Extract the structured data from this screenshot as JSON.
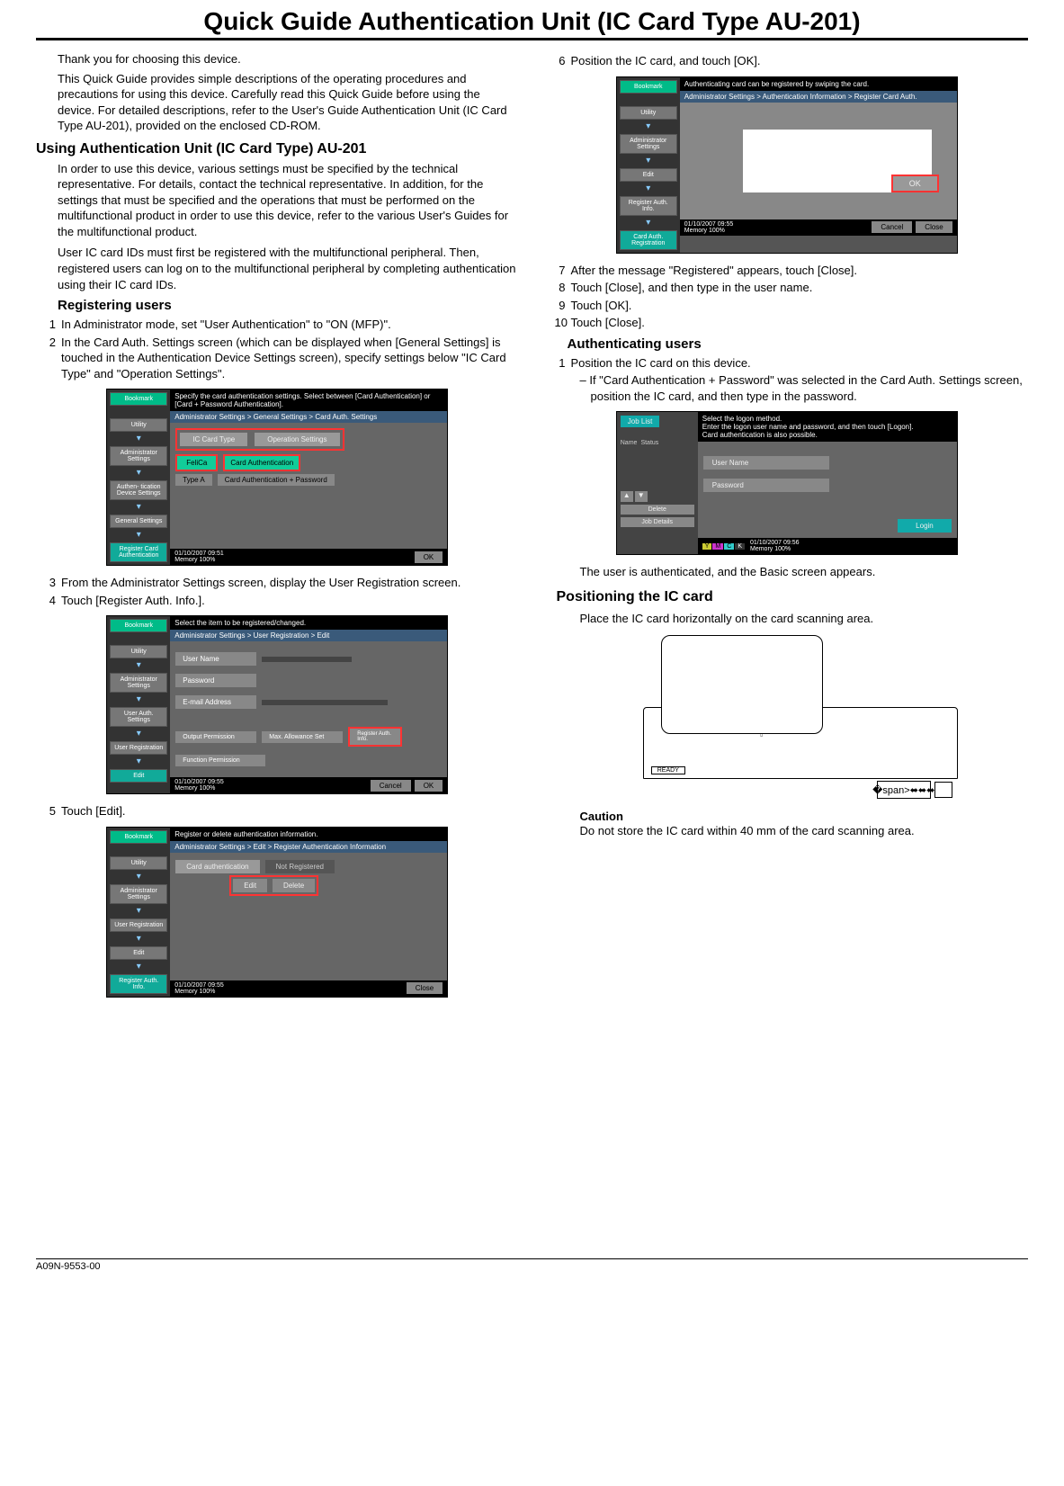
{
  "title": "Quick Guide Authentication Unit (IC Card Type AU-201)",
  "intro": {
    "p1": "Thank you for choosing this device.",
    "p2": "This Quick Guide provides simple descriptions of the operating procedures and precautions for using this device. Carefully read this Quick Guide before using the device. For detailed descriptions, refer to the User's Guide Authentication Unit (IC Card Type AU-201), provided on the enclosed CD-ROM."
  },
  "section_using": {
    "heading": "Using Authentication Unit (IC Card Type) AU-201",
    "p1": "In order to use this device, various settings must be specified by the technical representative. For details, contact the technical representative. In addition, for the settings that must be specified and the operations that must be performed on the multifunctional product in order to use this device, refer to the various User's Guides for the multifunctional product.",
    "p2": "User IC card IDs must first be registered with the multifunctional peripheral. Then, registered users can log on to the multifunctional peripheral by completing authentication using their IC card IDs."
  },
  "section_register": {
    "heading": "Registering users",
    "steps": {
      "s1": "In Administrator mode, set \"User Authentication\" to \"ON (MFP)\".",
      "s2": "In the Card Auth. Settings screen (which can be displayed when [General Settings] is touched in the Authentication Device Settings screen), specify settings below \"IC Card Type\" and \"Operation Settings\".",
      "s3": "From the Administrator Settings screen, display the User Registration screen.",
      "s4": "Touch [Register Auth. Info.].",
      "s5": "Touch [Edit].",
      "s6": "Position the IC card, and touch [OK].",
      "s7": "After the message \"Registered\" appears, touch [Close].",
      "s8": "Touch [Close], and then type in the user name.",
      "s9": "Touch [OK].",
      "s10": "Touch [Close]."
    }
  },
  "section_auth": {
    "heading": "Authenticating users",
    "step1": "Position the IC card on this device.",
    "sub1": "– If \"Card Authentication + Password\" was selected in the Card Auth. Settings screen, position the IC card, and then type in the password.",
    "result": "The user is authenticated, and the Basic screen appears."
  },
  "section_position": {
    "heading": "Positioning the IC card",
    "p1": "Place the IC card horizontally on the card scanning area.",
    "caution_h": "Caution",
    "caution_t": "Do not store the IC card within 40 mm of the card scanning area."
  },
  "footer_code": "A09N-9553-00",
  "screenshots": {
    "ss1": {
      "head": "Specify the card authentication settings.\nSelect between [Card Authentication] or [Card + Password Authentication].",
      "crumb": "Administrator Settings > General Settings > Card Auth. Settings",
      "side": {
        "bookmark": "Bookmark",
        "utility": "Utility",
        "admin": "Administrator Settings",
        "authdev": "Authen- tication Device Settings",
        "general": "General Settings",
        "regcard": "Register Card Authentication"
      },
      "tab_ic": "IC Card Type",
      "tab_op": "Operation Settings",
      "felica": "FeliCa",
      "cardauth": "Card Authentication",
      "typea": "Type A",
      "cardpass": "Card Authentication + Password",
      "date": "01/10/2007   09:51",
      "mem": "Memory        100%",
      "ok": "OK"
    },
    "ss2": {
      "head": "Select the item to be registered/changed.",
      "crumb": "Administrator Settings > User Registration > Edit",
      "side": {
        "bookmark": "Bookmark",
        "utility": "Utility",
        "admin": "Administrator Settings",
        "userauth": "User Auth. Settings",
        "userreg": "User Registration",
        "edit": "Edit"
      },
      "user": "User Name",
      "pass": "Password",
      "email": "E-mail Address",
      "output": "Output Permission",
      "maxallow": "Max. Allowance Set",
      "regauth": "Register Auth. Info.",
      "funcperm": "Function Permission",
      "date": "01/10/2007   09:55",
      "mem": "Memory        100%",
      "cancel": "Cancel",
      "ok": "OK"
    },
    "ss3": {
      "head": "Register or delete authentication information.",
      "crumb": "Administrator Settings > Edit > Register Authentication Information",
      "side": {
        "bookmark": "Bookmark",
        "utility": "Utility",
        "admin": "Administrator Settings",
        "userreg": "User Registration",
        "edit": "Edit",
        "regauth": "Register Auth. Info."
      },
      "cardauth": "Card authentication",
      "notreg": "Not Registered",
      "edit": "Edit",
      "delete": "Delete",
      "date": "01/10/2007   09:55",
      "mem": "Memory        100%",
      "close": "Close"
    },
    "ss4": {
      "head": "Authenticating card can be registered by swiping the card.",
      "crumb": "Administrator Settings > Authentication Information > Register Card Auth.",
      "side": {
        "bookmark": "Bookmark",
        "utility": "Utility",
        "admin": "Administrator Settings",
        "edit": "Edit",
        "regauth": "Register Auth. Info.",
        "cardreg": "Card Auth. Registration"
      },
      "ok": "OK",
      "date": "01/10/2007   09:55",
      "mem": "Memory        100%",
      "cancel": "Cancel",
      "close": "Close"
    },
    "ss5": {
      "head": "Select the logon method.\nEnter the logon user name and password, and then touch [Logon].\nCard authentication is also possible.",
      "joblist": "Job List",
      "name": "Name",
      "status": "Status",
      "user": "User Name",
      "pass": "Password",
      "delete": "Delete",
      "jobdetails": "Job Details",
      "login": "Login",
      "date": "01/10/2007   09:56",
      "mem": "Memory        100%"
    },
    "diagram": {
      "ready": "READY",
      "usb": "⬌"
    }
  }
}
